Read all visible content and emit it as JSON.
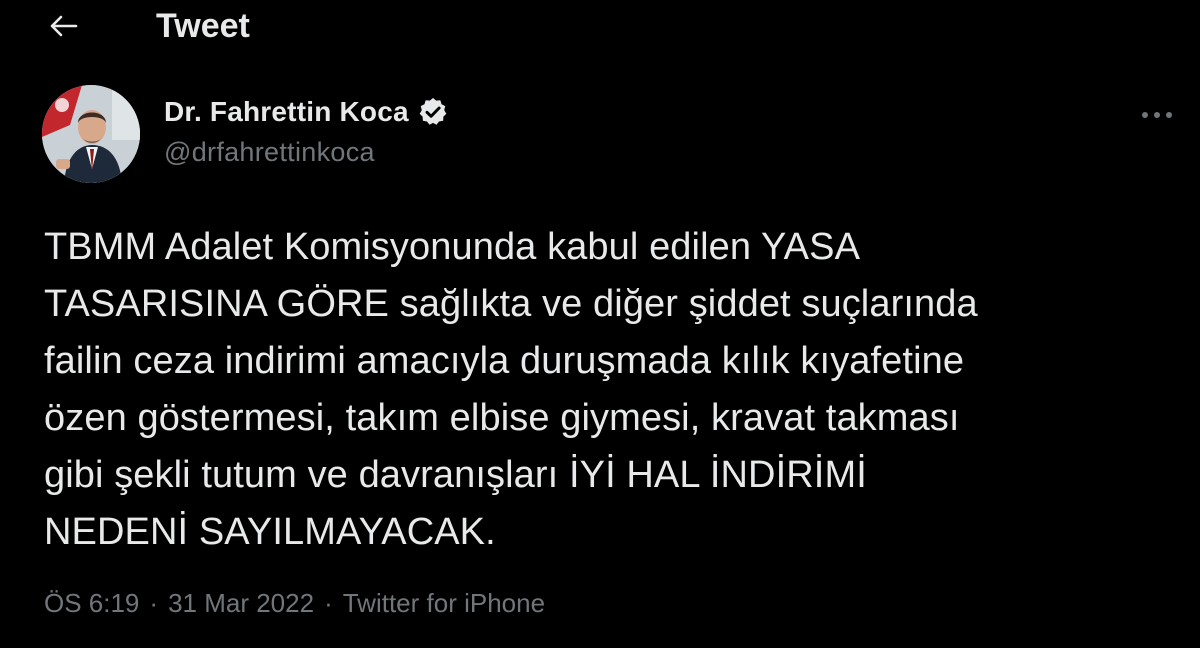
{
  "header": {
    "title": "Tweet",
    "back_icon": "arrow-left-icon"
  },
  "author": {
    "display_name": "Dr. Fahrettin Koca",
    "handle": "@drfahrettinkoca",
    "verified_icon": "verified-badge-icon"
  },
  "more_icon": "more-horizontal-icon",
  "tweet": {
    "text": "TBMM Adalet Komisyonunda kabul edilen YASA\nTASARISINA GÖRE sağlıkta ve diğer şiddet suçlarında\nfailin ceza indirimi amacıyla duruşmada kılık kıyafetine\nözen göstermesi, takım elbise giymesi, kravat takması\ngibi şekli tutum ve davranışları İYİ HAL İNDİRİMİ\nNEDENİ SAYILMAYACAK."
  },
  "meta": {
    "time": "ÖS 6:19",
    "separator": "·",
    "date": "31 Mar 2022",
    "source": "Twitter for iPhone"
  },
  "colors": {
    "background": "#000000",
    "primary_text": "#e7e9ea",
    "secondary_text": "#71767b"
  }
}
